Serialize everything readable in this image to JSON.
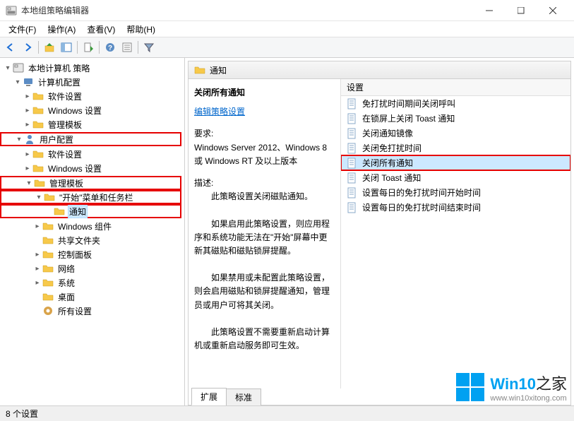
{
  "window": {
    "title": "本地组策略编辑器"
  },
  "menus": [
    "文件(F)",
    "操作(A)",
    "查看(V)",
    "帮助(H)"
  ],
  "tree": {
    "root": "本地计算机 策略",
    "computer": {
      "label": "计算机配置",
      "children": [
        "软件设置",
        "Windows 设置",
        "管理模板"
      ]
    },
    "user": {
      "label": "用户配置",
      "software": "软件设置",
      "windows": "Windows 设置",
      "admin": {
        "label": "管理模板",
        "start": {
          "label": "\"开始\"菜单和任务栏",
          "notif": "通知"
        },
        "others": [
          "Windows 组件",
          "共享文件夹",
          "控制面板",
          "网络",
          "系统",
          "桌面",
          "所有设置"
        ]
      }
    }
  },
  "right": {
    "header": "通知",
    "detail": {
      "title": "关闭所有通知",
      "edit_link": "编辑策略设置",
      "req_label": "要求:",
      "req_text": "Windows Server 2012、Windows 8 或 Windows RT 及以上版本",
      "desc_label": "描述:",
      "p1": "此策略设置关闭磁贴通知。",
      "p2": "如果启用此策略设置，则应用程序和系统功能无法在\"开始\"屏幕中更新其磁贴和磁贴锁屏提醒。",
      "p3": "如果禁用或未配置此策略设置，则会启用磁贴和锁屏提醒通知，管理员或用户可将其关闭。",
      "p4": "此策略设置不需要重新启动计算机或重新启动服务即可生效。"
    },
    "list": {
      "header": "设置",
      "items": [
        "免打扰时间期间关闭呼叫",
        "在锁屏上关闭 Toast 通知",
        "关闭通知镜像",
        "关闭免打扰时间",
        "关闭所有通知",
        "关闭 Toast 通知",
        "设置每日的免打扰时间开始时间",
        "设置每日的免打扰时间结束时间"
      ],
      "selected_index": 4
    },
    "tabs": {
      "extended": "扩展",
      "standard": "标准"
    }
  },
  "status": "8 个设置",
  "watermark": {
    "brand": "Win10",
    "suffix": "之家",
    "url": "www.win10xitong.com"
  }
}
